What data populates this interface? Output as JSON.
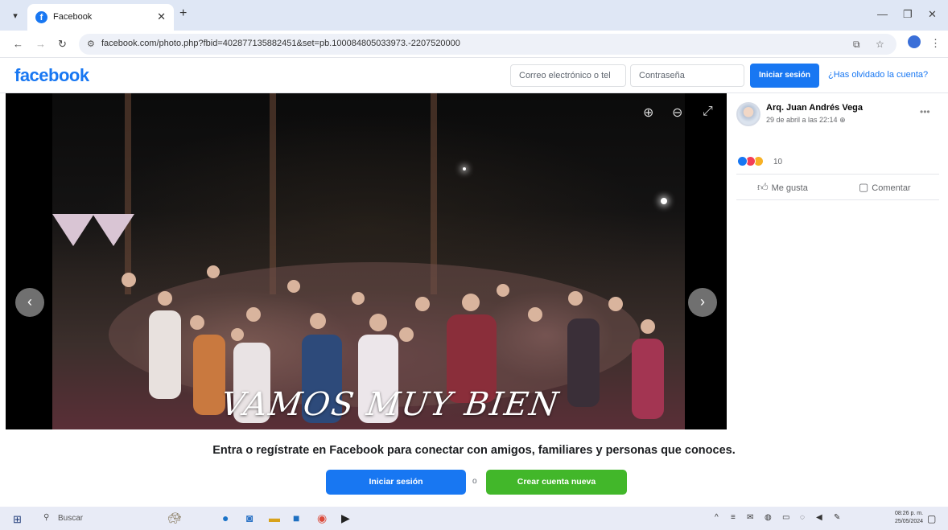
{
  "browser": {
    "tab_title": "Facebook",
    "tab_favicon": "f",
    "url": "facebook.com/photo.php?fbid=402877135882451&set=pb.100084805033973.-2207520000"
  },
  "header": {
    "logo": "facebook",
    "email_placeholder": "Correo electrónico o tel",
    "password_placeholder": "Contraseña",
    "login_label": "Iniciar sesión",
    "forgot_label": "¿Has olvidado la cuenta?"
  },
  "photo": {
    "caption": "VAMOS MUY BIEN"
  },
  "post": {
    "author": "Arq. Juan Andrés Vega",
    "date": "29 de abril a las 22:14",
    "privacy_icon": "globe-icon",
    "reaction_count": "10",
    "like_label": "Me gusta",
    "comment_label": "Comentar"
  },
  "banner": {
    "text": "Entra o regístrate en Facebook para conectar con amigos, familiares y personas que conoces.",
    "login_label": "Iniciar sesión",
    "separator": "o",
    "register_label": "Crear cuenta nueva"
  },
  "taskbar": {
    "search_placeholder": "Buscar",
    "time": "08:26 p. m.",
    "date": "25/05/2024"
  },
  "colors": {
    "brand": "#1877f2",
    "register": "#42b72a",
    "like_reaction": "#1877f2",
    "love_reaction": "#f33e58",
    "care_reaction": "#f7b125"
  }
}
